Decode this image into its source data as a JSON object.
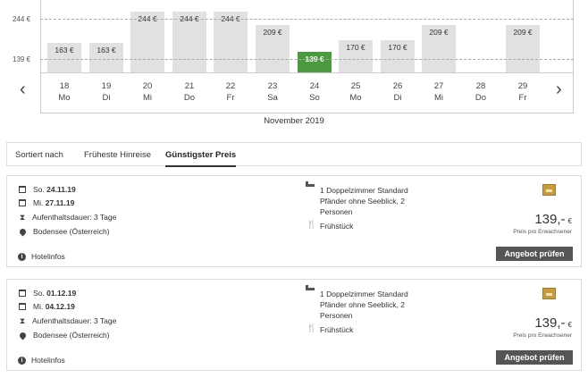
{
  "chart": {
    "y_ticks": [
      "244 €",
      "139 €"
    ],
    "month": "November 2019",
    "prev_icon": "chevron-left-icon",
    "next_icon": "chevron-right-icon"
  },
  "chart_data": {
    "type": "bar",
    "categories": [
      "18",
      "19",
      "20",
      "21",
      "22",
      "23",
      "24",
      "25",
      "26",
      "27",
      "28",
      "29"
    ],
    "weekdays": [
      "Mo",
      "Di",
      "Mi",
      "Do",
      "Fr",
      "Sa",
      "So",
      "Mo",
      "Di",
      "Mi",
      "Do",
      "Fr"
    ],
    "values": [
      163,
      163,
      244,
      244,
      244,
      209,
      139,
      170,
      170,
      209,
      null,
      209
    ],
    "labels": [
      "163 €",
      "163 €",
      "244 €",
      "244 €",
      "244 €",
      "209 €",
      "139 €",
      "170 €",
      "170 €",
      "209 €",
      "",
      "209 €"
    ],
    "selected_index": 6,
    "yticks": [
      139,
      244
    ],
    "ylim": [
      100,
      244
    ],
    "xlabel": "November 2019",
    "grid": true,
    "selected_color": "#4a9a3e",
    "bar_color": "#e1e1e1"
  },
  "sort": {
    "label": "Sortiert nach",
    "options": [
      {
        "label": "Früheste Hinreise",
        "active": false
      },
      {
        "label": "Günstigster Preis",
        "active": true
      }
    ]
  },
  "offers": [
    {
      "depart_prefix": "So.",
      "depart_date": "24.11.19",
      "return_prefix": "Mi.",
      "return_date": "27.11.19",
      "duration": "Aufenthaltsdauer: 3 Tage",
      "location": "Bodensee (Österreich)",
      "hotelinfo": "Hotelinfos",
      "room_lines": [
        "1 Doppelzimmer Standard",
        "Pfänder ohne Seeblick, 2",
        "Personen"
      ],
      "meal": "Frühstück",
      "price": "139,-",
      "currency": "€",
      "price_note": "Preis pro Erwachsener",
      "cta": "Angebot prüfen"
    },
    {
      "depart_prefix": "So.",
      "depart_date": "01.12.19",
      "return_prefix": "Mi.",
      "return_date": "04.12.19",
      "duration": "Aufenthaltsdauer: 3 Tage",
      "location": "Bodensee (Österreich)",
      "hotelinfo": "Hotelinfos",
      "room_lines": [
        "1 Doppelzimmer Standard",
        "Pfänder ohne Seeblick, 2",
        "Personen"
      ],
      "meal": "Frühstück",
      "price": "139,-",
      "currency": "€",
      "price_note": "Preis pro Erwachsener",
      "cta": "Angebot prüfen"
    }
  ]
}
